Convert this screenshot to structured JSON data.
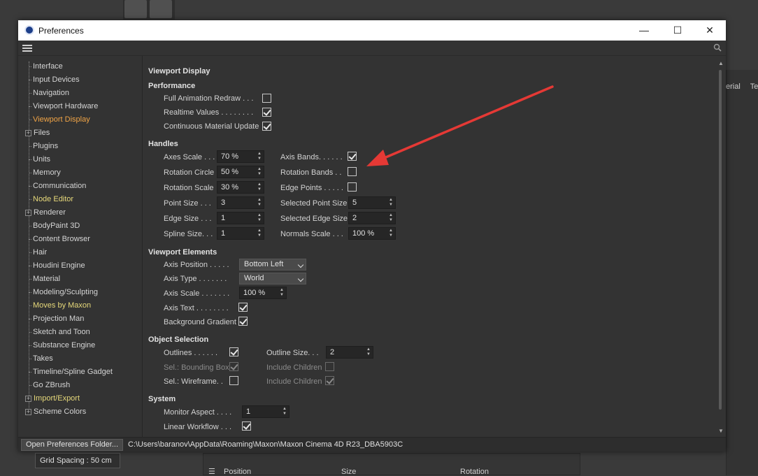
{
  "window": {
    "title": "Preferences",
    "minimize": "—",
    "maximize": "☐",
    "close": "✕"
  },
  "sidebar": {
    "items": [
      {
        "label": "Interface",
        "color": "normal",
        "expandable": false
      },
      {
        "label": "Input Devices",
        "color": "normal",
        "expandable": false
      },
      {
        "label": "Navigation",
        "color": "normal",
        "expandable": false
      },
      {
        "label": "Viewport Hardware",
        "color": "normal",
        "expandable": false
      },
      {
        "label": "Viewport Display",
        "color": "orange",
        "expandable": false
      },
      {
        "label": "Files",
        "color": "normal",
        "expandable": true
      },
      {
        "label": "Plugins",
        "color": "normal",
        "expandable": false
      },
      {
        "label": "Units",
        "color": "normal",
        "expandable": false
      },
      {
        "label": "Memory",
        "color": "normal",
        "expandable": false
      },
      {
        "label": "Communication",
        "color": "normal",
        "expandable": false
      },
      {
        "label": "Node Editor",
        "color": "yellow",
        "expandable": false
      },
      {
        "label": "Renderer",
        "color": "normal",
        "expandable": true
      },
      {
        "label": "BodyPaint 3D",
        "color": "normal",
        "expandable": false
      },
      {
        "label": "Content Browser",
        "color": "normal",
        "expandable": false
      },
      {
        "label": "Hair",
        "color": "normal",
        "expandable": false
      },
      {
        "label": "Houdini Engine",
        "color": "normal",
        "expandable": false
      },
      {
        "label": "Material",
        "color": "normal",
        "expandable": false
      },
      {
        "label": "Modeling/Sculpting",
        "color": "normal",
        "expandable": false
      },
      {
        "label": "Moves by Maxon",
        "color": "yellow",
        "expandable": false
      },
      {
        "label": "Projection Man",
        "color": "normal",
        "expandable": false
      },
      {
        "label": "Sketch and Toon",
        "color": "normal",
        "expandable": false
      },
      {
        "label": "Substance Engine",
        "color": "normal",
        "expandable": false
      },
      {
        "label": "Takes",
        "color": "normal",
        "expandable": false
      },
      {
        "label": "Timeline/Spline Gadget",
        "color": "normal",
        "expandable": false
      },
      {
        "label": "Go ZBrush",
        "color": "normal",
        "expandable": false
      },
      {
        "label": "Import/Export",
        "color": "yellow",
        "expandable": true
      },
      {
        "label": "Scheme Colors",
        "color": "normal",
        "expandable": true
      }
    ]
  },
  "content": {
    "page_title": "Viewport Display",
    "performance": {
      "heading": "Performance",
      "full_anim": {
        "label": "Full Animation Redraw . . .",
        "checked": false
      },
      "realtime": {
        "label": "Realtime Values . . . . . . . .",
        "checked": true
      },
      "continuous": {
        "label": "Continuous Material Update",
        "checked": true
      }
    },
    "handles": {
      "heading": "Handles",
      "axes_scale": {
        "label": "Axes Scale . . .",
        "value": "70 %"
      },
      "rotation_circle": {
        "label": "Rotation Circle",
        "value": "50 %"
      },
      "rotation_scale": {
        "label": "Rotation Scale",
        "value": "30 %"
      },
      "point_size": {
        "label": "Point Size . . .",
        "value": "3"
      },
      "edge_size": {
        "label": "Edge Size . . .",
        "value": "1"
      },
      "spline_size": {
        "label": "Spline Size. . .",
        "value": "1"
      },
      "axis_bands": {
        "label": "Axis Bands. . . . . .",
        "checked": true
      },
      "rotation_bands": {
        "label": "Rotation Bands . .",
        "checked": false
      },
      "edge_points": {
        "label": "Edge Points . . . . .",
        "checked": false
      },
      "selected_point_size": {
        "label": "Selected Point Size",
        "value": "5"
      },
      "selected_edge_size": {
        "label": "Selected Edge Size",
        "value": "2"
      },
      "normals_scale": {
        "label": "Normals Scale . . .",
        "value": "100 %"
      }
    },
    "viewport_elements": {
      "heading": "Viewport Elements",
      "axis_position": {
        "label": "Axis Position . . . . .",
        "value": "Bottom Left"
      },
      "axis_type": {
        "label": "Axis Type . . . . . . .",
        "value": "World"
      },
      "axis_scale": {
        "label": "Axis Scale . . . . . . .",
        "value": "100 %"
      },
      "axis_text": {
        "label": "Axis Text . . . . . . . .",
        "checked": true
      },
      "bg_gradient": {
        "label": "Background Gradient",
        "checked": true
      }
    },
    "object_selection": {
      "heading": "Object Selection",
      "outlines": {
        "label": "Outlines . . . . . .",
        "checked": true
      },
      "bounding_box": {
        "label": "Sel.: Bounding Box",
        "checked": true
      },
      "wireframe": {
        "label": "Sel.: Wireframe. .",
        "checked": false
      },
      "outline_size": {
        "label": "Outline Size. . .",
        "value": "2"
      },
      "include_children_1": {
        "label": "Include Children",
        "checked": false
      },
      "include_children_2": {
        "label": "Include Children",
        "checked": true
      }
    },
    "system": {
      "heading": "System",
      "monitor_aspect": {
        "label": "Monitor Aspect . . . .",
        "value": "1"
      },
      "linear_workflow": {
        "label": "Linear Workflow . . .",
        "checked": true
      }
    }
  },
  "bottom": {
    "open_button": "Open Preferences Folder...",
    "path": "C:\\Users\\baranov\\AppData\\Roaming\\Maxon\\Maxon Cinema 4D R23_DBA5903C"
  },
  "background": {
    "right_tabs": [
      "erial",
      "Te"
    ],
    "grid_spacing": "Grid Spacing : 50 cm",
    "bottom_cols": [
      "Position",
      "Size",
      "Rotation"
    ]
  },
  "colors": {
    "accent_orange": "#f0a446",
    "accent_yellow": "#e6d87a",
    "arrow_red": "#e53935"
  }
}
